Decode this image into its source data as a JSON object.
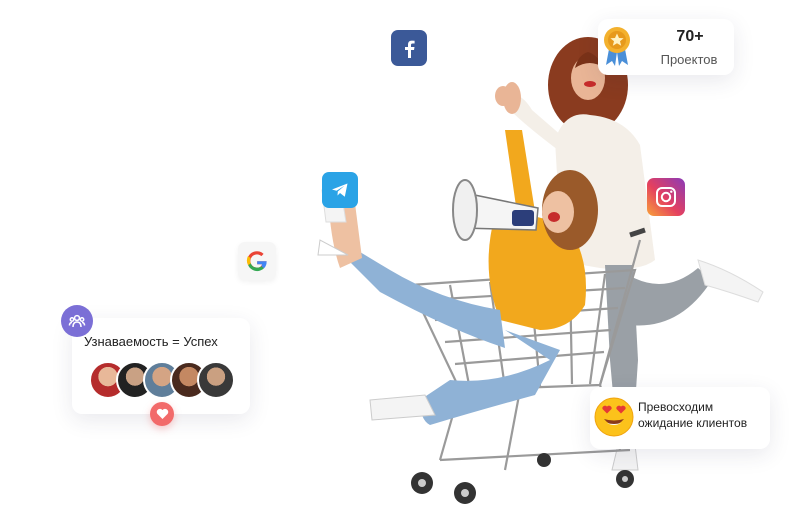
{
  "stats": {
    "number": "70+",
    "label": "Проектов"
  },
  "recognition": {
    "title": "Узнаваемость = Успех"
  },
  "exceed": {
    "line1": "Превосходим",
    "line2": "ожидание клиентов"
  },
  "icons": {
    "facebook": "facebook-icon",
    "telegram": "telegram-icon",
    "google": "google-icon",
    "instagram": "instagram-icon",
    "award": "award-badge-icon",
    "team": "team-icon",
    "heart": "heart-icon",
    "emoji": "heart-eyes-emoji-icon"
  },
  "colors": {
    "facebook": "#3b5998",
    "telegram": "#2aa3e6",
    "team": "#7b6fd6",
    "heart": "#f26a6a",
    "sweater": "#f2a81d",
    "jeans": "#8fb2d6"
  }
}
